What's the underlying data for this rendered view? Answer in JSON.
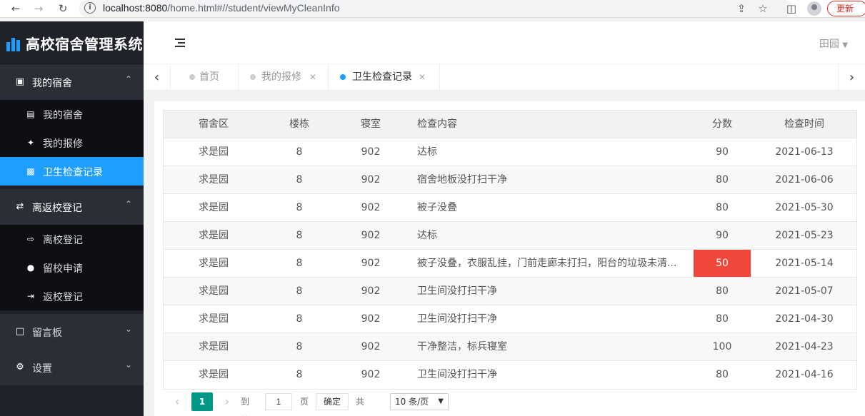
{
  "browser": {
    "url_host": "localhost:8080",
    "url_path": "/home.html#//student/viewMyCleanInfo",
    "update_label": "更新"
  },
  "app": {
    "title": "高校宿舍管理系统"
  },
  "sidebar": {
    "groups": [
      {
        "label": "我的宿舍",
        "icon": "cube-icon",
        "expanded": true,
        "items": [
          {
            "label": "我的宿舍",
            "icon": "bed-icon"
          },
          {
            "label": "我的报修",
            "icon": "wrench-icon"
          },
          {
            "label": "卫生检查记录",
            "icon": "bar-chart-icon",
            "active": true
          }
        ]
      },
      {
        "label": "离返校登记",
        "icon": "exchange-icon",
        "expanded": true,
        "items": [
          {
            "label": "离校登记",
            "icon": "sign-out-icon"
          },
          {
            "label": "留校申请",
            "icon": "globe-icon"
          },
          {
            "label": "返校登记",
            "icon": "sign-in-icon"
          }
        ]
      },
      {
        "label": "留言板",
        "icon": "calendar-icon",
        "expanded": false
      },
      {
        "label": "设置",
        "icon": "gear-icon",
        "expanded": false
      }
    ]
  },
  "header": {
    "user": "田园"
  },
  "tabs": [
    {
      "label": "首页",
      "closable": false
    },
    {
      "label": "我的报修",
      "closable": true
    },
    {
      "label": "卫生检查记录",
      "closable": true,
      "active": true
    }
  ],
  "table": {
    "columns": [
      "宿舍区",
      "楼栋",
      "寝室",
      "检查内容",
      "分数",
      "检查时间"
    ],
    "rows": [
      [
        "求是园",
        "8",
        "902",
        "达标",
        "90",
        "2021-06-13"
      ],
      [
        "求是园",
        "8",
        "902",
        "宿舍地板没打扫干净",
        "80",
        "2021-06-06"
      ],
      [
        "求是园",
        "8",
        "902",
        "被子没叠",
        "80",
        "2021-05-30"
      ],
      [
        "求是园",
        "8",
        "902",
        "达标",
        "90",
        "2021-05-23"
      ],
      [
        "求是园",
        "8",
        "902",
        "被子没叠，衣服乱挂，门前走廊未打扫，阳台的垃圾未清...",
        "50",
        "2021-05-14"
      ],
      [
        "求是园",
        "8",
        "902",
        "卫生间没打扫干净",
        "80",
        "2021-05-07"
      ],
      [
        "求是园",
        "8",
        "902",
        "卫生间没打扫干净",
        "80",
        "2021-04-30"
      ],
      [
        "求是园",
        "8",
        "902",
        "干净整洁，标兵寝室",
        "100",
        "2021-04-23"
      ],
      [
        "求是园",
        "8",
        "902",
        "卫生间没打扫干净",
        "80",
        "2021-04-16"
      ]
    ],
    "highlight_color": "#f0473a"
  },
  "pager": {
    "current": "1",
    "goto_label": "到第",
    "goto_value": "1",
    "page_label": "页",
    "confirm_label": "确定",
    "total_label": "共 9 条",
    "page_size": "10 条/页"
  }
}
